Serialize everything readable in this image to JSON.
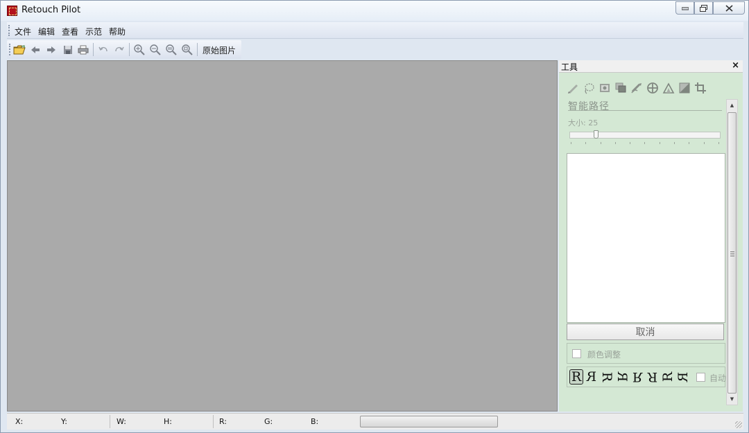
{
  "window": {
    "title": "Retouch Pilot",
    "controls": {
      "minimize": "▭",
      "maximize": "□",
      "close": "✕"
    }
  },
  "menu": [
    "文件",
    "编辑",
    "查看",
    "示范",
    "帮助"
  ],
  "toolbar": {
    "icons": [
      "open-folder-icon",
      "back-arrow-icon",
      "forward-arrow-icon",
      "save-icon",
      "print-icon",
      "undo-icon",
      "redo-icon",
      "zoom-in-icon",
      "zoom-out-icon",
      "zoom-fit-icon",
      "zoom-actual-icon"
    ],
    "original_image_label": "原始图片"
  },
  "panel": {
    "title": "工具",
    "close": "×",
    "tools": [
      "pencil-icon",
      "lasso-icon",
      "stamp-icon",
      "layers-icon",
      "brush-wand-icon",
      "patch-icon",
      "triangle-tool-icon",
      "adjust-icon",
      "crop-icon"
    ],
    "section_title": "智能路径",
    "size_label": "大小: 25",
    "size_value": 25,
    "cancel_label": "取消",
    "color_adjust_label": "颜色调整",
    "r_glyphs": [
      "R",
      "Я",
      "R",
      "ꓤ",
      "R",
      "Я",
      "ꓤ",
      "Я"
    ],
    "auto_label": "自动"
  },
  "statusbar": {
    "x": "X:",
    "y": "Y:",
    "w": "W:",
    "h": "H:",
    "r": "R:",
    "g": "G:",
    "b": "B:"
  },
  "colors": {
    "canvas": "#aaaaaa",
    "panel_bg": "#d4e8d4",
    "menubar": "#dde4f0"
  }
}
